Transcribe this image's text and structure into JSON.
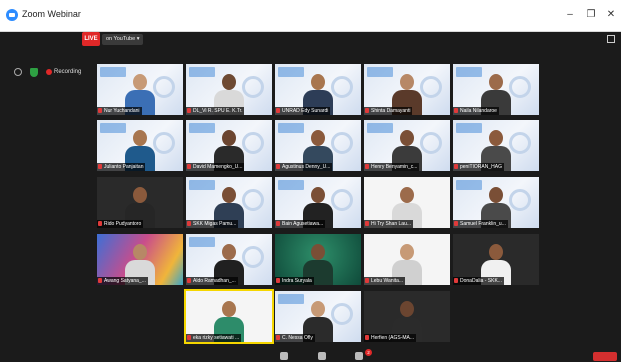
{
  "window": {
    "title": "Zoom Webinar",
    "minimize": "–",
    "maximize": "❐",
    "close": "✕"
  },
  "toolbar": {
    "recording_label": "Recording",
    "live_label": "LIVE",
    "youtube_label": "on YouTube ▾"
  },
  "participants": [
    {
      "name": "Nur Yuchandani",
      "style": "webinar",
      "skin": "#c79a76",
      "shirt": "#3b6fb5"
    },
    {
      "name": "DL_Vi R. SPU E. K.Tr.",
      "style": "webinar",
      "skin": "#6e4a33",
      "shirt": "#d9d9d9"
    },
    {
      "name": "UNRAD Edy Sunardi",
      "style": "webinar",
      "skin": "#a8764f",
      "shirt": "#2d3d57"
    },
    {
      "name": "Shinta Damayanti",
      "style": "webinar",
      "skin": "#b78866",
      "shirt": "#5a3a2a"
    },
    {
      "name": "Naila Nilandaroe",
      "style": "webinar",
      "skin": "#9c6b4b",
      "shirt": "#3a3a3a"
    },
    {
      "name": "Julianto Panjaitan",
      "style": "webinar",
      "skin": "#a8764f",
      "shirt": "#1f5a8c"
    },
    {
      "name": "David Mamengko_U...",
      "style": "webinar",
      "skin": "#6b4530",
      "shirt": "#2a2a2a"
    },
    {
      "name": "Agustinus Denny_U...",
      "style": "webinar",
      "skin": "#8b5a3c",
      "shirt": "#34495e"
    },
    {
      "name": "Henry Benyamin_c...",
      "style": "webinar",
      "skin": "#7a4f36",
      "shirt": "#3b3b3b"
    },
    {
      "name": "peniTIORAN_HAG",
      "style": "webinar",
      "skin": "#8b5a3c",
      "shirt": "#4a4a4a"
    },
    {
      "name": "Rido Pudyantoro",
      "style": "dark",
      "skin": "#8b5a3c",
      "shirt": "#262626"
    },
    {
      "name": "SKK Migas Pamu...",
      "style": "webinar",
      "skin": "#7a4f36",
      "shirt": "#2f3f55"
    },
    {
      "name": "Bain Agusetiawa...",
      "style": "webinar",
      "skin": "#7a4f36",
      "shirt": "#222222"
    },
    {
      "name": "Hi Try Shan Lau...",
      "style": "white",
      "skin": "#9c6b4b",
      "shirt": "#d9d9d9"
    },
    {
      "name": "Samuel Franklin_u...",
      "style": "webinar",
      "skin": "#7a4f36",
      "shirt": "#4a4a4a"
    },
    {
      "name": "Awang Satyana_...",
      "style": "colorful",
      "skin": "#b78866",
      "shirt": "#d9d9d9"
    },
    {
      "name": "Aldo Ramadhan_...",
      "style": "webinar",
      "skin": "#9c6b4b",
      "shirt": "#202020"
    },
    {
      "name": "Indra Suryala",
      "style": "green",
      "skin": "#7a4f36",
      "shirt": "#1c3b2f"
    },
    {
      "name": "Lebu Wanita...",
      "style": "white",
      "skin": "#c79a76",
      "shirt": "#d0d0d0"
    },
    {
      "name": "DonaDalia - SKK...",
      "style": "dark",
      "skin": "#8b5a3c",
      "shirt": "#f0f0f0"
    },
    {
      "name": "eka rizky setiawati ...",
      "style": "white",
      "skin": "#a8764f",
      "shirt": "#2d8c6a"
    },
    {
      "name": "C. Nessa Ofly",
      "style": "webinar",
      "skin": "#c79a76",
      "shirt": "#2b2b2b"
    },
    {
      "name": "Herfien (AGS-MA...",
      "style": "dark",
      "skin": "#6b4530",
      "shirt": "#2b2b2b"
    }
  ],
  "active_speaker": "eka rizky setiawati ...",
  "bottombar": {
    "participant_count": "2"
  }
}
